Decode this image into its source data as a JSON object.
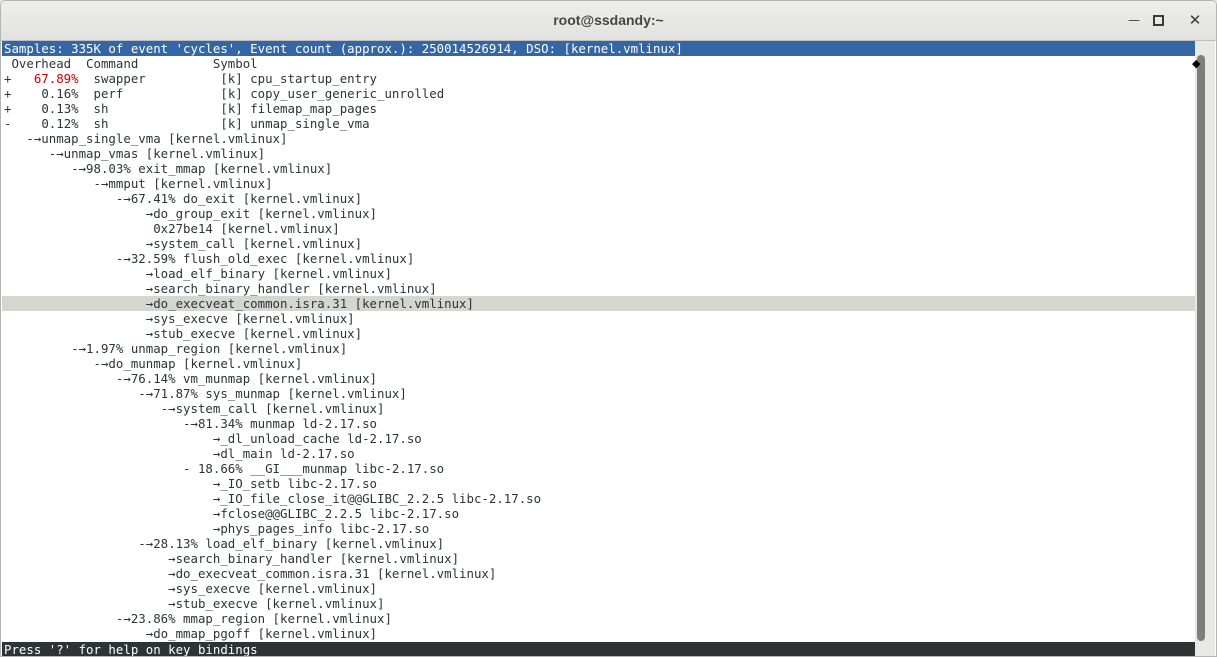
{
  "window": {
    "title": "root@ssdandy:~",
    "minimize_glyph": "—",
    "close_glyph": "✕"
  },
  "perf": {
    "header": "Samples: 335K of event 'cycles', Event count (approx.): 250014526914, DSO: [kernel.vmlinux]",
    "columns": " Overhead  Command          Symbol",
    "entries": [
      {
        "pre": "+   ",
        "pct": "67.89%",
        "post": "  swapper          [k] cpu_startup_entry",
        "red": true
      },
      {
        "pre": "+    ",
        "pct": "0.16%",
        "post": "  perf             [k] copy_user_generic_unrolled",
        "red": false
      },
      {
        "pre": "+    ",
        "pct": "0.13%",
        "post": "  sh               [k] filemap_map_pages",
        "red": false
      },
      {
        "pre": "-    ",
        "pct": "0.12%",
        "post": "  sh               [k] unmap_single_vma",
        "red": false
      }
    ],
    "tree": [
      "   -→unmap_single_vma [kernel.vmlinux]",
      "      -→unmap_vmas [kernel.vmlinux]",
      "         -→98.03% exit_mmap [kernel.vmlinux]",
      "            -→mmput [kernel.vmlinux]",
      "               -→67.41% do_exit [kernel.vmlinux]",
      "                   →do_group_exit [kernel.vmlinux]",
      "                    0x27be14 [kernel.vmlinux]",
      "                   →system_call [kernel.vmlinux]",
      "               -→32.59% flush_old_exec [kernel.vmlinux]",
      "                   →load_elf_binary [kernel.vmlinux]",
      "                   →search_binary_handler [kernel.vmlinux]",
      "                   →do_execveat_common.isra.31 [kernel.vmlinux]",
      "                   →sys_execve [kernel.vmlinux]",
      "                   →stub_execve [kernel.vmlinux]",
      "         -→1.97% unmap_region [kernel.vmlinux]",
      "            -→do_munmap [kernel.vmlinux]",
      "               -→76.14% vm_munmap [kernel.vmlinux]",
      "                  -→71.87% sys_munmap [kernel.vmlinux]",
      "                     -→system_call [kernel.vmlinux]",
      "                        -→81.34% munmap ld-2.17.so",
      "                            →_dl_unload_cache ld-2.17.so",
      "                            →dl_main ld-2.17.so",
      "                        - 18.66% __GI___munmap libc-2.17.so",
      "                            →_IO_setb libc-2.17.so",
      "                            →_IO_file_close_it@@GLIBC_2.2.5 libc-2.17.so",
      "                            →fclose@@GLIBC_2.2.5 libc-2.17.so",
      "                            →phys_pages_info libc-2.17.so",
      "                  -→28.13% load_elf_binary [kernel.vmlinux]",
      "                      →search_binary_handler [kernel.vmlinux]",
      "                      →do_execveat_common.isra.31 [kernel.vmlinux]",
      "                      →sys_execve [kernel.vmlinux]",
      "                      →stub_execve [kernel.vmlinux]",
      "               -→23.86% mmap_region [kernel.vmlinux]",
      "                   →do_mmap_pgoff [kernel.vmlinux]"
    ],
    "highlighted_row": 11,
    "status": "Press '?' for help on key bindings"
  },
  "colors": {
    "header_bg": "#3465a4",
    "highlight_bg": "#d3d7cf",
    "hot_pct": "#cc0000",
    "status_bg": "#2e3436"
  }
}
